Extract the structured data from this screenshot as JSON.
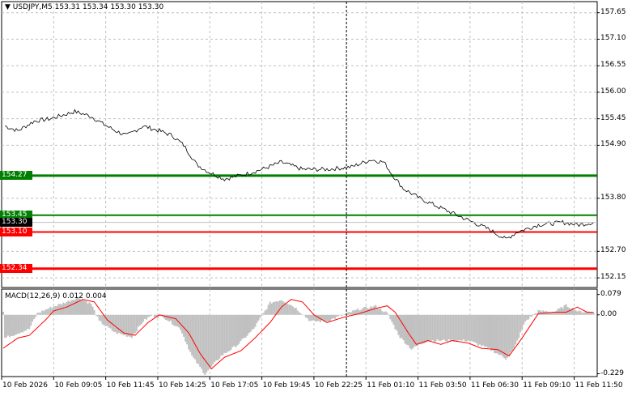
{
  "header": {
    "symbol": "USDJPY,M5",
    "ohlc": "153.31 153.34 153.30 153.30"
  },
  "colors": {
    "support": "#008000",
    "resistance": "#ff0000",
    "price_line": "#000000",
    "histogram": "#c0c0c0",
    "signal": "#ff0000",
    "grid": "#c0c0c0"
  },
  "price_axis": {
    "ticks": [
      "157.65",
      "157.10",
      "156.55",
      "156.00",
      "155.45",
      "154.90",
      "153.80",
      "152.70",
      "152.15"
    ],
    "values": [
      157.65,
      157.1,
      156.55,
      156.0,
      155.45,
      154.9,
      153.8,
      152.7,
      152.15
    ],
    "range": [
      151.95,
      157.88
    ]
  },
  "levels": [
    {
      "label": "154.27",
      "value": 154.27,
      "color": "#008000",
      "width": 3
    },
    {
      "label": "153.45",
      "value": 153.45,
      "color": "#008000",
      "width": 2
    },
    {
      "label": "153.10",
      "value": 153.1,
      "color": "#ff0000",
      "width": 2
    },
    {
      "label": "152.34",
      "value": 152.34,
      "color": "#ff0000",
      "width": 3
    }
  ],
  "current_price": {
    "label": "153.30",
    "value": 153.3
  },
  "macd": {
    "title": "MACD(12,26,9) 0.012 0.004",
    "ticks": [
      "0.079",
      "0.00",
      "-0.229"
    ],
    "tick_values": [
      0.079,
      0,
      -0.229
    ],
    "range": [
      -0.24,
      0.1
    ]
  },
  "time_axis": [
    "10 Feb 2026",
    "10 Feb 09:05",
    "10 Feb 11:45",
    "10 Feb 14:25",
    "10 Feb 17:05",
    "10 Feb 19:45",
    "10 Feb 22:25",
    "11 Feb 01:10",
    "11 Feb 03:50",
    "11 Feb 06:30",
    "11 Feb 09:10",
    "11 Feb 11:50"
  ],
  "cursor_bar": 212,
  "chart_data": {
    "type": "line",
    "bars_per_label": 32,
    "price": [
      [
        2,
        155.3
      ],
      [
        10,
        155.2
      ],
      [
        20,
        155.4
      ],
      [
        30,
        155.45
      ],
      [
        40,
        155.55
      ],
      [
        45,
        155.6
      ],
      [
        55,
        155.5
      ],
      [
        62,
        155.35
      ],
      [
        70,
        155.2
      ],
      [
        77,
        155.1
      ],
      [
        87,
        155.3
      ],
      [
        97,
        155.2
      ],
      [
        105,
        155.1
      ],
      [
        112,
        154.9
      ],
      [
        120,
        154.5
      ],
      [
        127,
        154.35
      ],
      [
        137,
        154.2
      ],
      [
        150,
        154.3
      ],
      [
        160,
        154.4
      ],
      [
        172,
        154.55
      ],
      [
        185,
        154.4
      ],
      [
        200,
        154.4
      ],
      [
        215,
        154.45
      ],
      [
        227,
        154.6
      ],
      [
        235,
        154.55
      ],
      [
        240,
        154.3
      ],
      [
        247,
        154.0
      ],
      [
        257,
        153.8
      ],
      [
        270,
        153.6
      ],
      [
        280,
        153.45
      ],
      [
        290,
        153.3
      ],
      [
        300,
        153.15
      ],
      [
        310,
        152.95
      ],
      [
        317,
        153.1
      ],
      [
        330,
        153.25
      ],
      [
        345,
        153.3
      ],
      [
        355,
        153.25
      ],
      [
        364,
        153.3
      ]
    ],
    "macd_hist": [
      [
        2,
        -0.09
      ],
      [
        17,
        -0.055
      ],
      [
        22,
        0.006
      ],
      [
        30,
        0.028
      ],
      [
        37,
        0.043
      ],
      [
        47,
        0.068
      ],
      [
        55,
        0.043
      ],
      [
        60,
        -0.025
      ],
      [
        70,
        -0.07
      ],
      [
        80,
        -0.086
      ],
      [
        87,
        -0.025
      ],
      [
        92,
        -0.003
      ],
      [
        100,
        -0.01
      ],
      [
        110,
        -0.055
      ],
      [
        117,
        -0.16
      ],
      [
        125,
        -0.23
      ],
      [
        135,
        -0.16
      ],
      [
        145,
        -0.117
      ],
      [
        155,
        -0.055
      ],
      [
        165,
        0.046
      ],
      [
        172,
        0.059
      ],
      [
        180,
        0.031
      ],
      [
        190,
        -0.025
      ],
      [
        200,
        -0.025
      ],
      [
        210,
        0
      ],
      [
        220,
        0.022
      ],
      [
        230,
        0.034
      ],
      [
        237,
        0.006
      ],
      [
        245,
        -0.087
      ],
      [
        252,
        -0.133
      ],
      [
        262,
        -0.1
      ],
      [
        275,
        -0.1
      ],
      [
        287,
        -0.1
      ],
      [
        300,
        -0.133
      ],
      [
        310,
        -0.17
      ],
      [
        315,
        -0.133
      ],
      [
        322,
        -0.025
      ],
      [
        330,
        0.015
      ],
      [
        340,
        0.012
      ],
      [
        347,
        0.037
      ],
      [
        355,
        0.012
      ],
      [
        364,
        0.012
      ]
    ],
    "macd_signal": [
      [
        1,
        -0.13
      ],
      [
        10,
        -0.09
      ],
      [
        17,
        -0.08
      ],
      [
        27,
        -0.02
      ],
      [
        32,
        0.015
      ],
      [
        40,
        0.03
      ],
      [
        50,
        0.06
      ],
      [
        57,
        0.05
      ],
      [
        65,
        -0.02
      ],
      [
        75,
        -0.07
      ],
      [
        82,
        -0.08
      ],
      [
        90,
        -0.03
      ],
      [
        97,
        0.0
      ],
      [
        107,
        -0.015
      ],
      [
        115,
        -0.07
      ],
      [
        122,
        -0.15
      ],
      [
        129,
        -0.21
      ],
      [
        137,
        -0.165
      ],
      [
        147,
        -0.14
      ],
      [
        155,
        -0.095
      ],
      [
        165,
        -0.03
      ],
      [
        172,
        0.03
      ],
      [
        178,
        0.06
      ],
      [
        185,
        0.05
      ],
      [
        192,
        0.0
      ],
      [
        200,
        -0.03
      ],
      [
        210,
        -0.01
      ],
      [
        220,
        0.005
      ],
      [
        230,
        0.025
      ],
      [
        237,
        0.035
      ],
      [
        242,
        0.01
      ],
      [
        250,
        -0.07
      ],
      [
        255,
        -0.115
      ],
      [
        262,
        -0.1
      ],
      [
        270,
        -0.115
      ],
      [
        277,
        -0.1
      ],
      [
        287,
        -0.11
      ],
      [
        295,
        -0.13
      ],
      [
        305,
        -0.135
      ],
      [
        312,
        -0.16
      ],
      [
        320,
        -0.09
      ],
      [
        330,
        0.005
      ],
      [
        340,
        0.01
      ],
      [
        347,
        0.01
      ],
      [
        354,
        0.03
      ],
      [
        360,
        0.01
      ],
      [
        364,
        0.01
      ]
    ]
  }
}
